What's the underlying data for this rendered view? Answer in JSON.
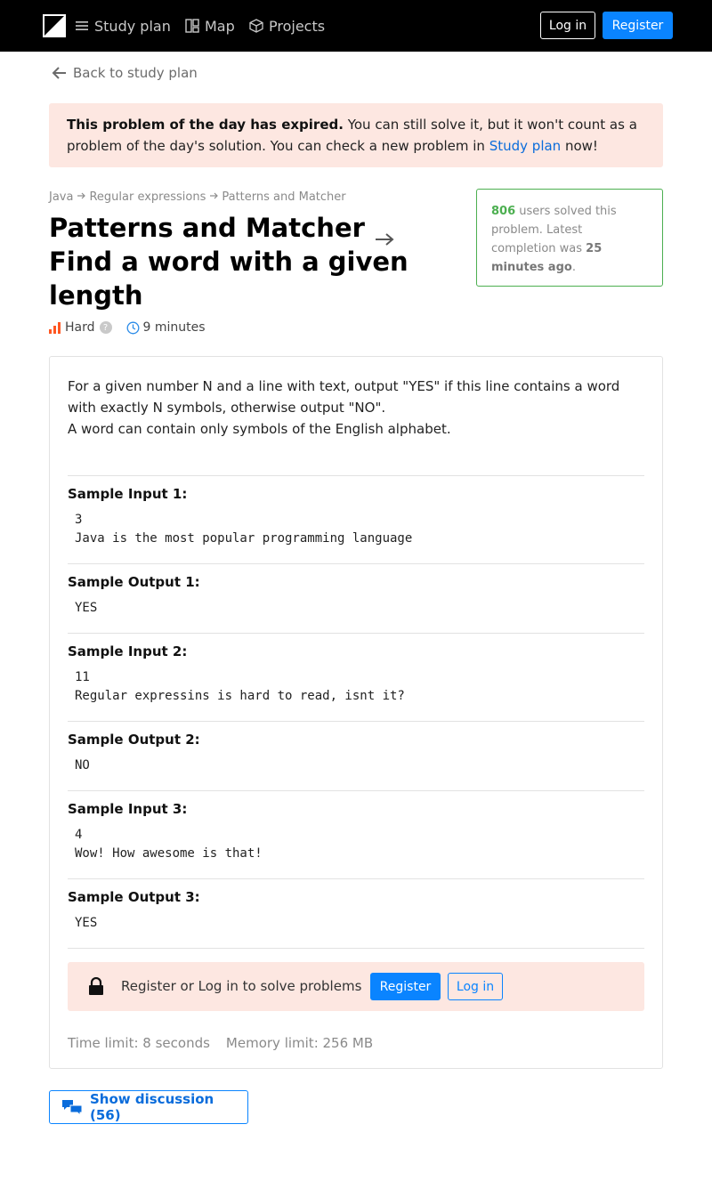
{
  "nav": {
    "items": [
      {
        "label": "Study plan",
        "icon": "menu-icon"
      },
      {
        "label": "Map",
        "icon": "map-icon"
      },
      {
        "label": "Projects",
        "icon": "cube-icon"
      }
    ],
    "login_label": "Log in",
    "register_label": "Register"
  },
  "back_link": "Back to study plan",
  "alert": {
    "bold": "This problem of the day has expired.",
    "text": " You can still solve it, but it won't count as a problem of the day's solution. You can check a new problem in ",
    "link": "Study plan",
    "tail": " now!"
  },
  "breadcrumb": [
    "Java",
    "Regular expressions",
    "Patterns and Matcher"
  ],
  "title": {
    "topic": "Patterns and Matcher",
    "problem": "Find a word with a given length"
  },
  "meta": {
    "difficulty": "Hard",
    "help": "?",
    "time": "9 minutes"
  },
  "solved": {
    "count": "806",
    "text": " users solved this problem. Latest completion was ",
    "ago": "25 minutes ago",
    "period": "."
  },
  "description": {
    "line1": "For a given number N and a line with text, output \"YES\" if this line contains a word with exactly N symbols, otherwise output \"NO\".",
    "line2": "A word can contain only symbols of the English alphabet."
  },
  "samples": [
    {
      "title": "Sample Input 1:",
      "code": "3\nJava is the most popular programming language"
    },
    {
      "title": "Sample Output 1:",
      "code": "YES"
    },
    {
      "title": "Sample Input 2:",
      "code": "11\nRegular expressins is hard to read, isnt it?"
    },
    {
      "title": "Sample Output 2:",
      "code": "NO"
    },
    {
      "title": "Sample Input 3:",
      "code": "4\nWow! How awesome is that!"
    },
    {
      "title": "Sample Output 3:",
      "code": "YES"
    }
  ],
  "lock_bar": {
    "text": "Register or Log in to solve problems",
    "register_label": "Register",
    "login_label": "Log in"
  },
  "limits": {
    "time": "Time limit: 8 seconds",
    "memory": "Memory limit: 256 MB"
  },
  "discussion": "Show discussion (56)",
  "colors": {
    "accent": "#0a84ff",
    "success": "#4caf50",
    "alert_bg": "#fde7e1",
    "difficulty": "#ff5722"
  }
}
